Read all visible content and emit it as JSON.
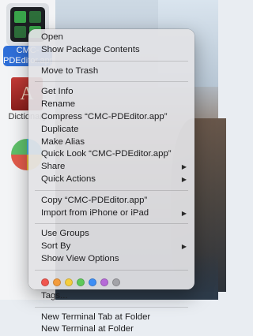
{
  "finder": {
    "selected_label": "CMC-PDEditor.app",
    "dictionary_label": "Dictionary",
    "dictionary_glyph": "A"
  },
  "menu": {
    "groups": [
      [
        {
          "label": "Open",
          "submenu": false
        },
        {
          "label": "Show Package Contents",
          "submenu": false
        }
      ],
      [
        {
          "label": "Move to Trash",
          "submenu": false
        }
      ],
      [
        {
          "label": "Get Info",
          "submenu": false
        },
        {
          "label": "Rename",
          "submenu": false
        },
        {
          "label": "Compress “CMC-PDEditor.app”",
          "submenu": false
        },
        {
          "label": "Duplicate",
          "submenu": false
        },
        {
          "label": "Make Alias",
          "submenu": false
        },
        {
          "label": "Quick Look “CMC-PDEditor.app”",
          "submenu": false
        },
        {
          "label": "Share",
          "submenu": true
        },
        {
          "label": "Quick Actions",
          "submenu": true
        }
      ],
      [
        {
          "label": "Copy “CMC-PDEditor.app”",
          "submenu": false
        },
        {
          "label": "Import from iPhone or iPad",
          "submenu": true
        }
      ],
      [
        {
          "label": "Use Groups",
          "submenu": false
        },
        {
          "label": "Sort By",
          "submenu": true
        },
        {
          "label": "Show View Options",
          "submenu": false
        }
      ]
    ],
    "tag_colors": [
      {
        "name": "red",
        "color": "#f0554e"
      },
      {
        "name": "orange",
        "color": "#f39c3d"
      },
      {
        "name": "yellow",
        "color": "#f5cd3d"
      },
      {
        "name": "green",
        "color": "#5ec95a"
      },
      {
        "name": "blue",
        "color": "#3d8ef5"
      },
      {
        "name": "purple",
        "color": "#b66ad8"
      },
      {
        "name": "gray",
        "color": "#a3a3a8"
      }
    ],
    "tags_label": "Tags...",
    "services": [
      {
        "label": "New Terminal Tab at Folder"
      },
      {
        "label": "New Terminal at Folder"
      }
    ],
    "submenu_glyph": "▶"
  }
}
